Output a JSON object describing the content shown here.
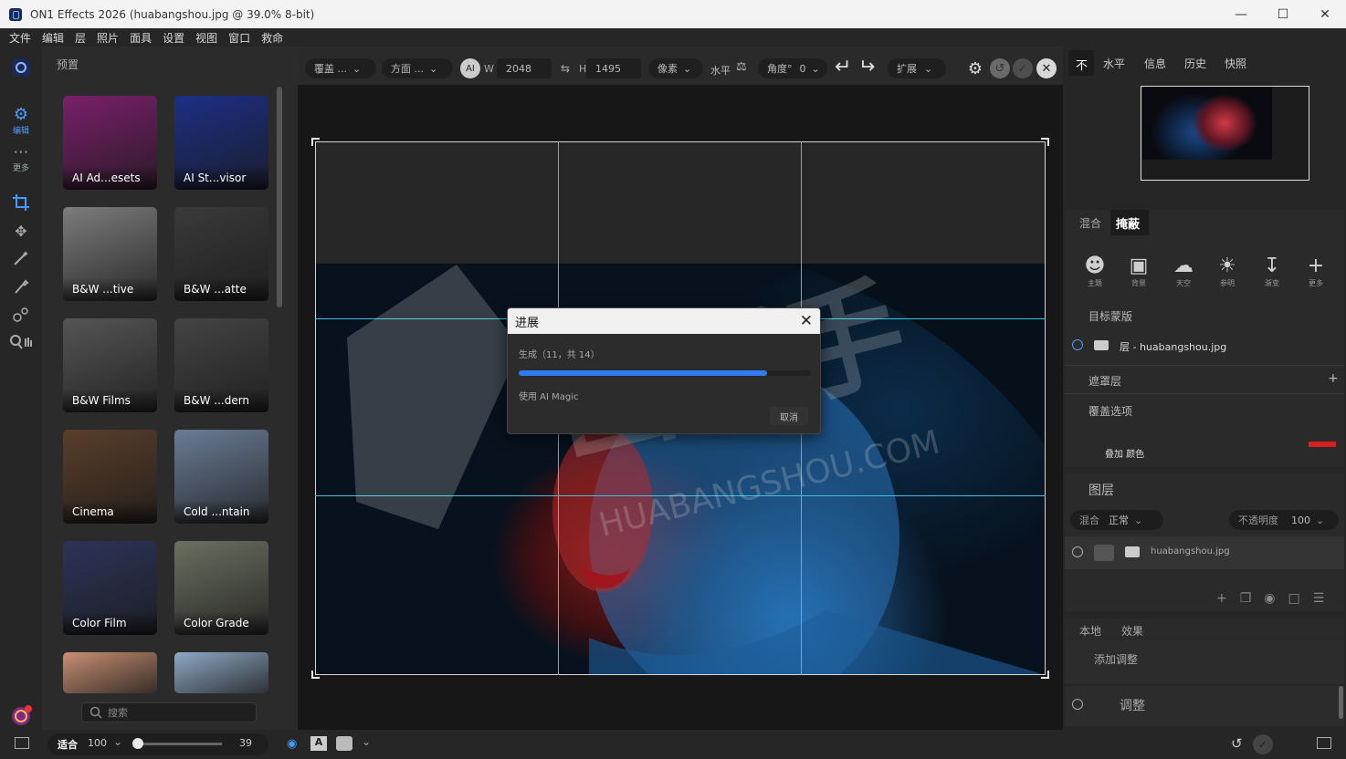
{
  "window": {
    "title": "ON1 Effects 2026 (huabangshou.jpg @ 39.0% 8-bit)"
  },
  "menu": [
    "文件",
    "编辑",
    "层",
    "照片",
    "面具",
    "设置",
    "视图",
    "窗口",
    "救命"
  ],
  "left_tools": [
    {
      "icon": "gear-icon",
      "label": "编辑"
    },
    {
      "icon": "more-icon",
      "label": "更多"
    },
    {
      "icon": "crop-icon",
      "label": ""
    },
    {
      "icon": "move-icon",
      "label": ""
    },
    {
      "icon": "wand-icon",
      "label": ""
    },
    {
      "icon": "brush-icon",
      "label": ""
    },
    {
      "icon": "shapes-icon",
      "label": ""
    },
    {
      "icon": "zoom-hand-icon",
      "label": ""
    }
  ],
  "presets": {
    "header": "预置",
    "items": [
      {
        "label": "AI Ad...esets",
        "color": "#7a1f6b"
      },
      {
        "label": "AI St...visor",
        "color": "#1c2f86"
      },
      {
        "label": "B&W ...tive",
        "color": "#7c7c7c"
      },
      {
        "label": "B&W ...atte",
        "color": "#3a3a3a"
      },
      {
        "label": "B&W Films",
        "color": "#555555"
      },
      {
        "label": "B&W ...dern",
        "color": "#444444"
      },
      {
        "label": "Cinema",
        "color": "#5a3e2a"
      },
      {
        "label": "Cold ...ntain",
        "color": "#6a7c96"
      },
      {
        "label": "Color Film",
        "color": "#2c3458"
      },
      {
        "label": "Color Grade",
        "color": "#6b7060"
      },
      {
        "label": "",
        "color": "#c98f72"
      },
      {
        "label": "",
        "color": "#8fa9c5"
      }
    ],
    "search_placeholder": "搜索"
  },
  "options": {
    "overlay": "覆盖  ...",
    "aspect": "方面  ...",
    "w_label": "W",
    "w_value": "2048",
    "h_label": "H",
    "h_value": "1495",
    "unit": "像素",
    "level": "水平",
    "angle_label": "角度°",
    "angle_value": "0",
    "expand": "扩展"
  },
  "dialog": {
    "title": "进展",
    "progress_text": "生成（11，共 14）",
    "progress": 0.85,
    "subtitle": "使用 AI Magic",
    "cancel": "取消"
  },
  "watermark": {
    "main": "画帮手",
    "sub": "HUABANGSHOU.COM"
  },
  "right": {
    "tabs": [
      "不",
      "水平",
      "信息",
      "历史",
      "快照"
    ],
    "mask_tabs": [
      "混合",
      "掩蔽"
    ],
    "mask_tools": [
      {
        "icon": "person-icon",
        "label": "主题"
      },
      {
        "icon": "portrait-icon",
        "label": "背景"
      },
      {
        "icon": "sky-icon",
        "label": "天空"
      },
      {
        "icon": "lighthouse-icon",
        "label": "参明"
      },
      {
        "icon": "gradient-icon",
        "label": "渐变"
      },
      {
        "icon": "plus-icon",
        "label": "更多"
      }
    ],
    "target_mask": "目标蒙版",
    "target_file": "层 - huabangshou.jpg",
    "mask_layer": "遮罩层",
    "overlay_options": "覆盖选项",
    "overlay_small": "叠加  颜色",
    "layers_title": "图层",
    "blend_label": "混合",
    "blend_value": "正常",
    "opacity_label": "不透明度",
    "opacity_value": "100",
    "layer_name": "huabangshou.jpg",
    "bottom_tabs": [
      "本地",
      "效果"
    ],
    "add_adjust": "添加调整",
    "adjust": "调整"
  },
  "status": {
    "fit": "适合",
    "zoom": "100",
    "slider_value": "39",
    "slider_fraction": 0.02
  },
  "colors": {
    "accent": "#2f7cf0",
    "guide": "#38c6de",
    "red_swatch": "#d42020"
  }
}
